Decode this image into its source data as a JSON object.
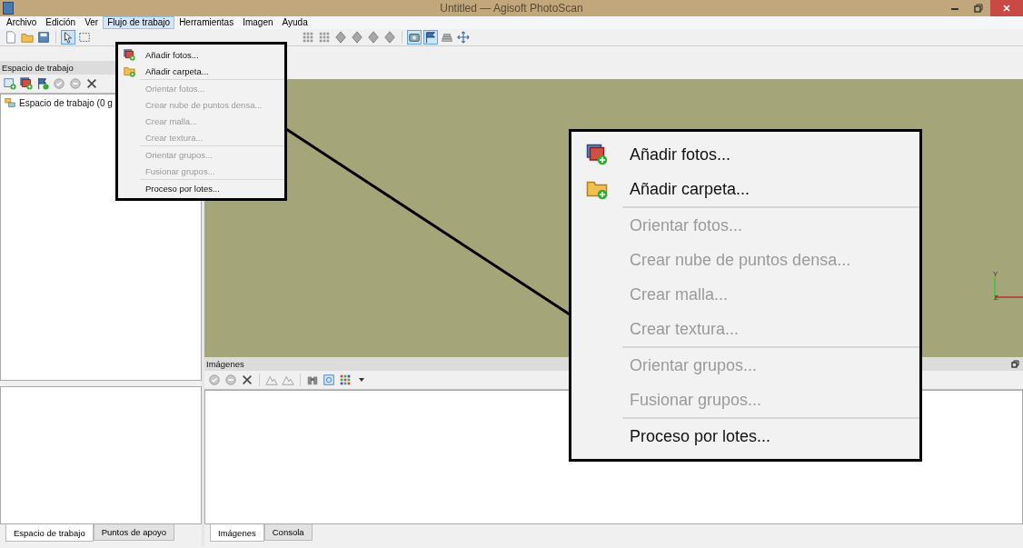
{
  "window": {
    "title": "Untitled — Agisoft PhotoScan"
  },
  "menu_bar": [
    {
      "label": "Archivo",
      "selected": false
    },
    {
      "label": "Edición",
      "selected": false
    },
    {
      "label": "Ver",
      "selected": false
    },
    {
      "label": "Flujo de trabajo",
      "selected": true
    },
    {
      "label": "Herramientas",
      "selected": false
    },
    {
      "label": "Imagen",
      "selected": false
    },
    {
      "label": "Ayuda",
      "selected": false
    }
  ],
  "toolbar": {
    "left": [
      {
        "kind": "new",
        "selected": false
      },
      {
        "kind": "open",
        "selected": false
      },
      {
        "kind": "save",
        "selected": false
      },
      {
        "kind": "sep"
      },
      {
        "kind": "pointer",
        "selected": true
      },
      {
        "kind": "rect-select",
        "selected": false
      }
    ],
    "right": [
      {
        "kind": "grid",
        "selected": false
      },
      {
        "kind": "grid",
        "selected": false
      },
      {
        "kind": "pyramid",
        "selected": false
      },
      {
        "kind": "pyramid",
        "selected": false
      },
      {
        "kind": "pyramid",
        "selected": false
      },
      {
        "kind": "pyramid",
        "selected": false
      },
      {
        "kind": "sep"
      },
      {
        "kind": "camera",
        "selected": true
      },
      {
        "kind": "flag",
        "selected": true
      },
      {
        "kind": "stack",
        "selected": false
      },
      {
        "kind": "move",
        "selected": false
      }
    ]
  },
  "workspace_panel": {
    "title": "Espacio de trabajo",
    "toolbar": [
      {
        "kind": "chunk-add"
      },
      {
        "kind": "photos"
      },
      {
        "kind": "markers"
      },
      {
        "kind": "check"
      },
      {
        "kind": "minus"
      },
      {
        "kind": "x"
      }
    ],
    "tree": [
      {
        "label": "Espacio de trabajo (0 g"
      }
    ],
    "tabs": [
      {
        "label": "Espacio de trabajo",
        "selected": true
      },
      {
        "label": "Puntos de apoyo",
        "selected": false
      }
    ]
  },
  "viewport": {
    "axis_labels": [
      "Y",
      "Z"
    ]
  },
  "images_panel": {
    "title": "Imágenes",
    "toolbar": [
      {
        "kind": "check"
      },
      {
        "kind": "minus"
      },
      {
        "kind": "x"
      },
      {
        "kind": "sep"
      },
      {
        "kind": "mountain"
      },
      {
        "kind": "mountain"
      },
      {
        "kind": "sep"
      },
      {
        "kind": "binoculars"
      },
      {
        "kind": "target"
      },
      {
        "kind": "color-grid"
      },
      {
        "kind": "caret"
      }
    ],
    "tabs": [
      {
        "label": "Imágenes",
        "selected": true
      },
      {
        "label": "Consola",
        "selected": false
      }
    ]
  },
  "workflow_menu": {
    "groups": [
      {
        "items": [
          {
            "kind": "photos",
            "label": "Añadir fotos...",
            "disabled": false
          },
          {
            "kind": "folder",
            "label": "Añadir carpeta...",
            "disabled": false
          }
        ]
      },
      {
        "items": [
          {
            "kind": "text",
            "label": "Orientar fotos...",
            "disabled": true
          },
          {
            "kind": "text",
            "label": "Crear nube de puntos densa...",
            "disabled": true
          },
          {
            "kind": "text",
            "label": "Crear malla...",
            "disabled": true
          },
          {
            "kind": "text",
            "label": "Crear textura...",
            "disabled": true
          }
        ]
      },
      {
        "items": [
          {
            "kind": "text",
            "label": "Orientar grupos...",
            "disabled": true
          },
          {
            "kind": "text",
            "label": "Fusionar grupos...",
            "disabled": true
          }
        ]
      },
      {
        "items": [
          {
            "kind": "text",
            "label": "Proceso por lotes...",
            "disabled": false
          }
        ]
      }
    ]
  },
  "callout": {
    "groups": [
      {
        "items": [
          {
            "kind": "photos",
            "label": "Añadir fotos...",
            "disabled": false
          },
          {
            "kind": "folder",
            "label": "Añadir carpeta...",
            "disabled": false
          }
        ]
      },
      {
        "items": [
          {
            "kind": "text",
            "label": "Orientar fotos...",
            "disabled": true
          },
          {
            "kind": "text",
            "label": "Crear nube de puntos densa...",
            "disabled": true
          },
          {
            "kind": "text",
            "label": "Crear malla...",
            "disabled": true
          },
          {
            "kind": "text",
            "label": "Crear textura...",
            "disabled": true
          }
        ]
      },
      {
        "items": [
          {
            "kind": "text",
            "label": "Orientar grupos...",
            "disabled": true
          },
          {
            "kind": "text",
            "label": "Fusionar grupos...",
            "disabled": true
          }
        ]
      },
      {
        "items": [
          {
            "kind": "text",
            "label": "Proceso por lotes...",
            "disabled": false
          }
        ]
      }
    ]
  }
}
